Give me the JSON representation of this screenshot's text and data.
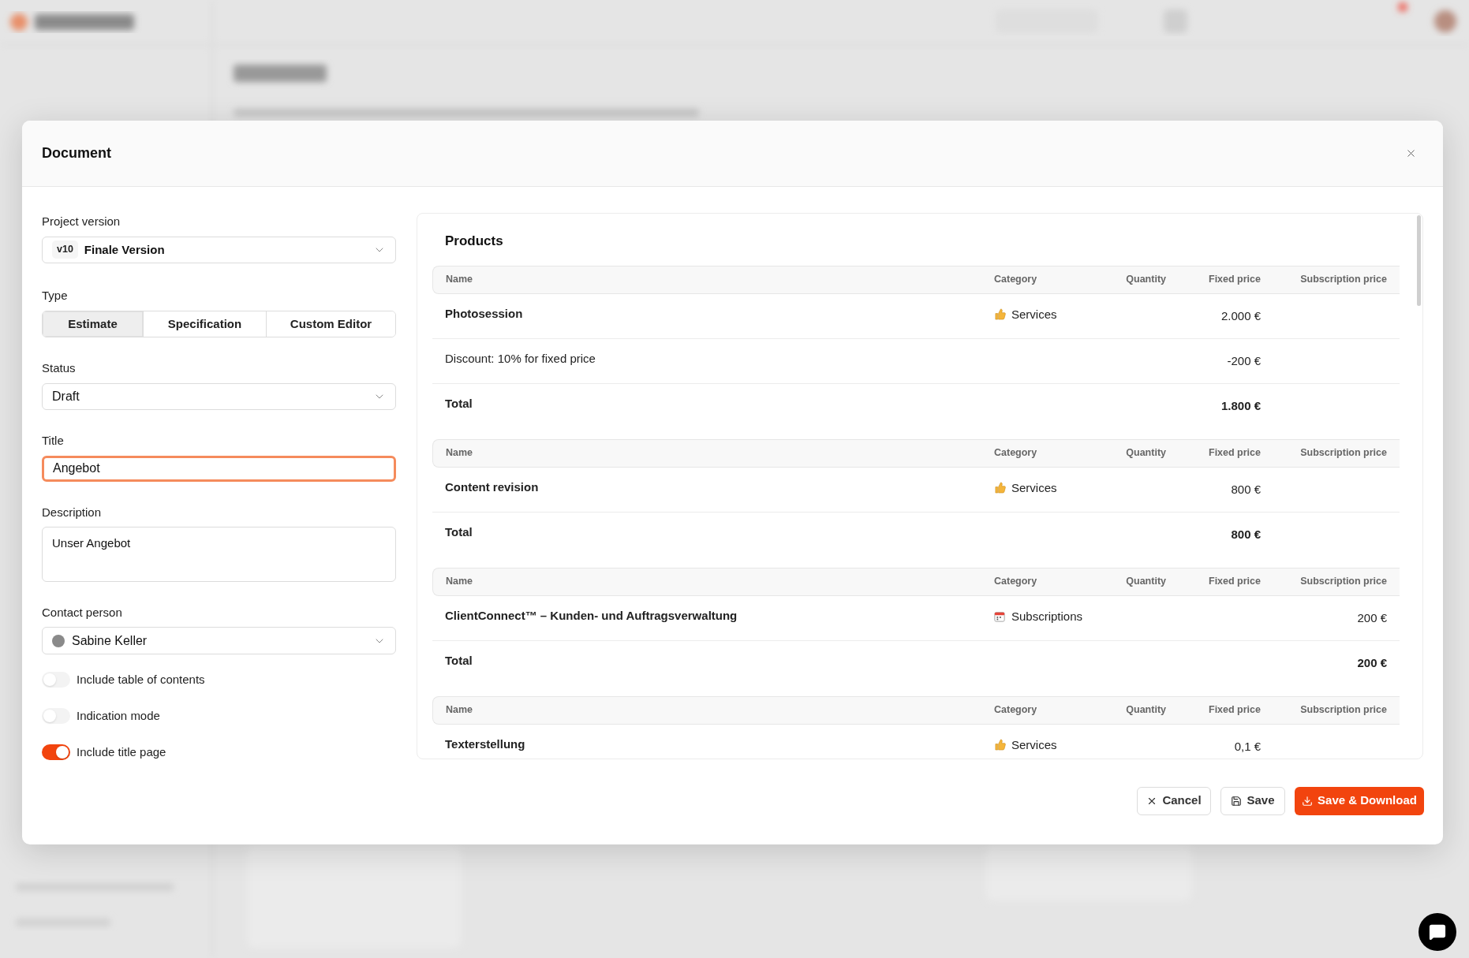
{
  "dialog": {
    "title": "Document"
  },
  "form": {
    "project_version": {
      "label": "Project version",
      "badge": "v10",
      "value": "Finale Version"
    },
    "type": {
      "label": "Type",
      "options": [
        {
          "label": "Estimate",
          "selected": true
        },
        {
          "label": "Specification",
          "selected": false
        },
        {
          "label": "Custom Editor",
          "selected": false
        }
      ]
    },
    "status": {
      "label": "Status",
      "value": "Draft"
    },
    "title": {
      "label": "Title",
      "value": "Angebot",
      "focused": true
    },
    "description": {
      "label": "Description",
      "value": "Unser Angebot"
    },
    "contact_person": {
      "label": "Contact person",
      "value": "Sabine Keller"
    },
    "toggles": [
      {
        "label": "Include table of contents",
        "on": false
      },
      {
        "label": "Indication mode",
        "on": false
      },
      {
        "label": "Include title page",
        "on": true
      }
    ]
  },
  "products": {
    "title": "Products",
    "groups": [
      {
        "columns": [
          "Name",
          "Category",
          "Quantity",
          "Fixed price",
          "Subscription price"
        ],
        "rows": [
          {
            "kind": "item",
            "name": "Photosession",
            "category": {
              "kind": "service",
              "label": "Services"
            },
            "fixed_price": "2.000 €"
          },
          {
            "kind": "discount",
            "name": "Discount: 10% for fixed price",
            "fixed_price": "-200 €"
          },
          {
            "kind": "total",
            "name": "Total",
            "fixed_price": "1.800 €"
          }
        ]
      },
      {
        "columns": [
          "Name",
          "Category",
          "Quantity",
          "Fixed price",
          "Subscription price"
        ],
        "rows": [
          {
            "kind": "item",
            "name": "Content revision",
            "category": {
              "kind": "service",
              "label": "Services"
            },
            "fixed_price": "800 €"
          },
          {
            "kind": "total",
            "name": "Total",
            "fixed_price": "800 €"
          }
        ]
      },
      {
        "columns": [
          "Name",
          "Category",
          "Quantity",
          "Fixed price",
          "Subscription price"
        ],
        "rows": [
          {
            "kind": "item",
            "name": "ClientConnect™ – Kunden- und Auftragsverwaltung",
            "category": {
              "kind": "subscription",
              "label": "Subscriptions"
            },
            "subscription_price": "200 €"
          },
          {
            "kind": "total",
            "name": "Total",
            "subscription_price": "200 €"
          }
        ]
      },
      {
        "columns": [
          "Name",
          "Category",
          "Quantity",
          "Fixed price",
          "Subscription price"
        ],
        "rows": [
          {
            "kind": "item",
            "name": "Texterstellung",
            "category": {
              "kind": "service",
              "label": "Services"
            },
            "fixed_price": "0,1 €"
          }
        ]
      }
    ]
  },
  "footer": {
    "buttons": [
      {
        "kind": "cancel",
        "label": "Cancel"
      },
      {
        "kind": "save",
        "label": "Save"
      },
      {
        "kind": "download",
        "label": "Save & Download"
      }
    ]
  }
}
